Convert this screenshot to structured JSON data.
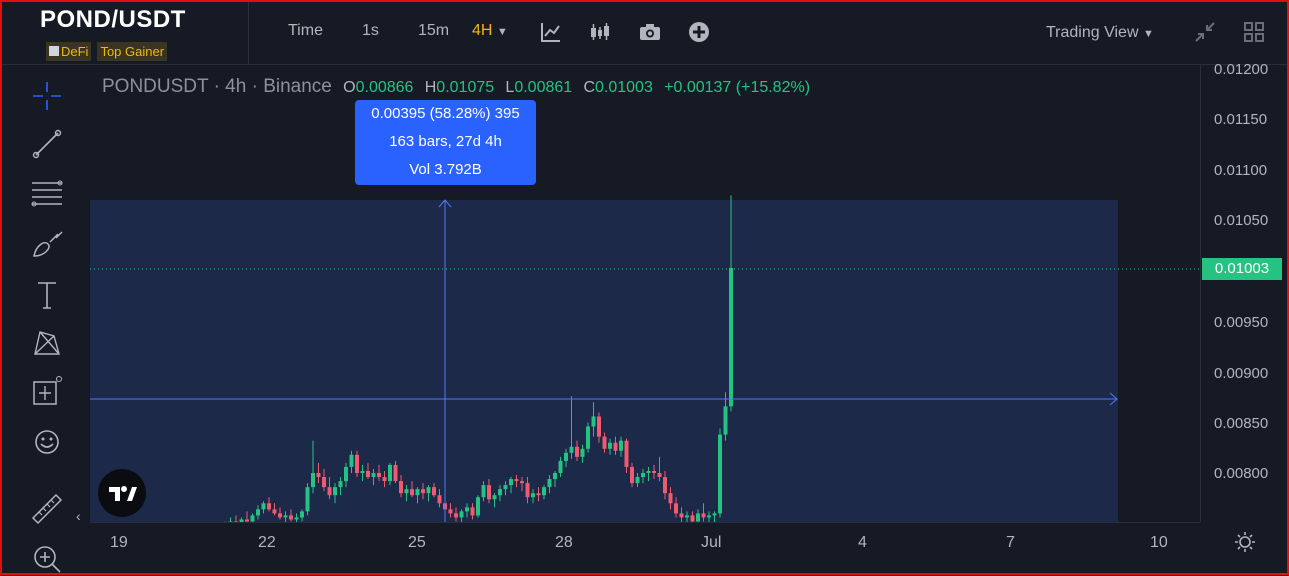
{
  "header": {
    "symbol": "POND/USDT",
    "tags": [
      "DeFi",
      "Top Gainer"
    ],
    "toolbar": {
      "time_label": "Time",
      "intervals": [
        "1s",
        "15m",
        "4H"
      ],
      "active_interval": "4H",
      "icons": [
        "indicators-icon",
        "candle-type-icon",
        "camera-icon",
        "add-icon"
      ]
    },
    "view_selector": "Trading View",
    "right_icons": [
      "collapse-icon",
      "layout-grid-icon"
    ]
  },
  "left_toolbar": {
    "tools": [
      "crosshair-icon",
      "trendline-icon",
      "fib-lines-icon",
      "brush-icon",
      "text-icon",
      "pattern-icon",
      "measure-icon",
      "emoji-icon",
      "ruler-icon",
      "zoom-in-icon"
    ]
  },
  "legend": {
    "symbol": "PONDUSDT",
    "interval": "4h",
    "exchange": "Binance",
    "open_label": "O",
    "open": "0.00866",
    "high_label": "H",
    "high": "0.01075",
    "low_label": "L",
    "low": "0.00861",
    "close_label": "C",
    "close": "0.01003",
    "change": "+0.00137 (+15.82%)"
  },
  "measure_tooltip": {
    "line1": "0.00395 (58.28%) 395",
    "line2": "163 bars, 27d 4h",
    "line3": "Vol 3.792B"
  },
  "price_axis": {
    "labels": [
      "0.01200",
      "0.01150",
      "0.01100",
      "0.01050",
      "0.01003",
      "0.00950",
      "0.00900",
      "0.00850",
      "0.00800"
    ],
    "current_price": "0.01003"
  },
  "time_axis": {
    "labels": [
      "19",
      "22",
      "25",
      "28",
      "Jul",
      "4",
      "7",
      "10"
    ]
  },
  "colors": {
    "up": "#26c281",
    "down": "#f05a6e",
    "measure": "#2962ff",
    "accent": "#f0b90b"
  },
  "chart_data": {
    "type": "candlestick",
    "y_range": [
      0.0075,
      0.0121
    ],
    "x_ticks": [
      "19",
      "22",
      "25",
      "28",
      "Jul",
      "4",
      "7",
      "10"
    ],
    "candles": [
      [
        0.00748,
        0.00752,
        0.00744,
        0.0075
      ],
      [
        0.0075,
        0.00756,
        0.00746,
        0.00752
      ],
      [
        0.00752,
        0.00758,
        0.00748,
        0.00749
      ],
      [
        0.00749,
        0.00756,
        0.00745,
        0.00754
      ],
      [
        0.00754,
        0.00762,
        0.0075,
        0.00752
      ],
      [
        0.00752,
        0.0076,
        0.00748,
        0.00758
      ],
      [
        0.00758,
        0.00768,
        0.00754,
        0.00764
      ],
      [
        0.00764,
        0.00772,
        0.0076,
        0.0077
      ],
      [
        0.0077,
        0.00776,
        0.00762,
        0.00764
      ],
      [
        0.00764,
        0.0077,
        0.00758,
        0.0076
      ],
      [
        0.0076,
        0.00766,
        0.00754,
        0.00756
      ],
      [
        0.00756,
        0.00762,
        0.0075,
        0.00758
      ],
      [
        0.00758,
        0.00764,
        0.00752,
        0.00754
      ],
      [
        0.00754,
        0.0076,
        0.00748,
        0.00756
      ],
      [
        0.00756,
        0.00764,
        0.00752,
        0.00762
      ],
      [
        0.00762,
        0.0079,
        0.00758,
        0.00786
      ],
      [
        0.00786,
        0.00832,
        0.0078,
        0.008
      ],
      [
        0.008,
        0.0081,
        0.0079,
        0.00796
      ],
      [
        0.00796,
        0.00804,
        0.00782,
        0.00786
      ],
      [
        0.00786,
        0.00796,
        0.00774,
        0.00778
      ],
      [
        0.00778,
        0.0079,
        0.0077,
        0.00786
      ],
      [
        0.00786,
        0.00796,
        0.00778,
        0.00792
      ],
      [
        0.00792,
        0.0081,
        0.00786,
        0.00806
      ],
      [
        0.00806,
        0.00822,
        0.008,
        0.00818
      ],
      [
        0.00818,
        0.00822,
        0.00796,
        0.008
      ],
      [
        0.008,
        0.00808,
        0.00792,
        0.00802
      ],
      [
        0.00802,
        0.0081,
        0.00794,
        0.00796
      ],
      [
        0.00796,
        0.00804,
        0.00788,
        0.008
      ],
      [
        0.008,
        0.00808,
        0.00792,
        0.00796
      ],
      [
        0.00796,
        0.00802,
        0.00786,
        0.00792
      ],
      [
        0.00792,
        0.0081,
        0.00788,
        0.00808
      ],
      [
        0.00808,
        0.00812,
        0.0079,
        0.00792
      ],
      [
        0.00792,
        0.00798,
        0.00776,
        0.0078
      ],
      [
        0.0078,
        0.00788,
        0.00772,
        0.00784
      ],
      [
        0.00784,
        0.00792,
        0.00776,
        0.00778
      ],
      [
        0.00778,
        0.00786,
        0.0077,
        0.00784
      ],
      [
        0.00784,
        0.0079,
        0.00774,
        0.0078
      ],
      [
        0.0078,
        0.00788,
        0.00772,
        0.00786
      ],
      [
        0.00786,
        0.0079,
        0.00776,
        0.00778
      ],
      [
        0.00778,
        0.00784,
        0.00766,
        0.0077
      ],
      [
        0.0077,
        0.00776,
        0.0076,
        0.00764
      ],
      [
        0.00764,
        0.0077,
        0.00756,
        0.0076
      ],
      [
        0.0076,
        0.00766,
        0.00752,
        0.00756
      ],
      [
        0.00756,
        0.00764,
        0.0075,
        0.00762
      ],
      [
        0.00762,
        0.0077,
        0.00756,
        0.00766
      ],
      [
        0.00766,
        0.0077,
        0.00754,
        0.00758
      ],
      [
        0.00758,
        0.00778,
        0.00756,
        0.00776
      ],
      [
        0.00776,
        0.00792,
        0.00772,
        0.00788
      ],
      [
        0.00788,
        0.00794,
        0.0077,
        0.00774
      ],
      [
        0.00774,
        0.0078,
        0.00766,
        0.00778
      ],
      [
        0.00778,
        0.00788,
        0.00772,
        0.00784
      ],
      [
        0.00784,
        0.00792,
        0.00778,
        0.00788
      ],
      [
        0.00788,
        0.00796,
        0.0078,
        0.00794
      ],
      [
        0.00794,
        0.00798,
        0.00786,
        0.00792
      ],
      [
        0.00792,
        0.00796,
        0.00782,
        0.0079
      ],
      [
        0.0079,
        0.00796,
        0.0077,
        0.00776
      ],
      [
        0.00776,
        0.00784,
        0.0077,
        0.0078
      ],
      [
        0.0078,
        0.00786,
        0.00772,
        0.00778
      ],
      [
        0.00778,
        0.00788,
        0.00774,
        0.00786
      ],
      [
        0.00786,
        0.00798,
        0.0078,
        0.00794
      ],
      [
        0.00794,
        0.00802,
        0.00786,
        0.008
      ],
      [
        0.008,
        0.00816,
        0.00796,
        0.00812
      ],
      [
        0.00812,
        0.00824,
        0.00806,
        0.0082
      ],
      [
        0.0082,
        0.00876,
        0.00814,
        0.00826
      ],
      [
        0.00826,
        0.00832,
        0.00812,
        0.00816
      ],
      [
        0.00816,
        0.00828,
        0.0081,
        0.00824
      ],
      [
        0.00824,
        0.0085,
        0.0082,
        0.00846
      ],
      [
        0.00846,
        0.0087,
        0.00836,
        0.00856
      ],
      [
        0.00856,
        0.0086,
        0.0083,
        0.00836
      ],
      [
        0.00836,
        0.0084,
        0.0082,
        0.00824
      ],
      [
        0.00824,
        0.00834,
        0.00818,
        0.0083
      ],
      [
        0.0083,
        0.00836,
        0.00818,
        0.00822
      ],
      [
        0.00822,
        0.00836,
        0.00816,
        0.00832
      ],
      [
        0.00832,
        0.00834,
        0.008,
        0.00806
      ],
      [
        0.00806,
        0.0081,
        0.00786,
        0.0079
      ],
      [
        0.0079,
        0.008,
        0.00786,
        0.00796
      ],
      [
        0.00796,
        0.00804,
        0.0079,
        0.008
      ],
      [
        0.008,
        0.00806,
        0.00792,
        0.00802
      ],
      [
        0.00802,
        0.00808,
        0.00794,
        0.008
      ],
      [
        0.008,
        0.00816,
        0.00792,
        0.00796
      ],
      [
        0.00796,
        0.00802,
        0.00774,
        0.0078
      ],
      [
        0.0078,
        0.00786,
        0.00764,
        0.0077
      ],
      [
        0.0077,
        0.00776,
        0.00756,
        0.0076
      ],
      [
        0.0076,
        0.00766,
        0.0075,
        0.00756
      ],
      [
        0.00756,
        0.00762,
        0.00748,
        0.00758
      ],
      [
        0.00758,
        0.00762,
        0.00748,
        0.00752
      ],
      [
        0.00752,
        0.00764,
        0.00746,
        0.0076
      ],
      [
        0.0076,
        0.0077,
        0.00752,
        0.00756
      ],
      [
        0.00756,
        0.00762,
        0.00748,
        0.00758
      ],
      [
        0.00758,
        0.00762,
        0.0075,
        0.0076
      ],
      [
        0.0076,
        0.00844,
        0.00756,
        0.00838
      ],
      [
        0.00838,
        0.0088,
        0.00832,
        0.00866
      ],
      [
        0.00866,
        0.01075,
        0.00861,
        0.01003
      ]
    ]
  }
}
